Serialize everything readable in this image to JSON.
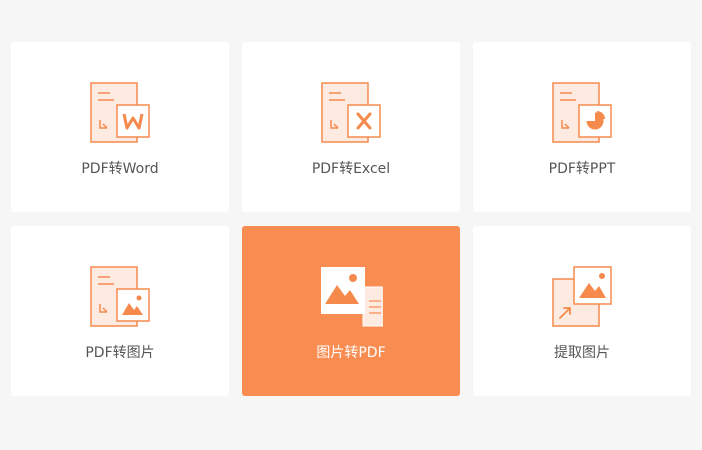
{
  "accent_color": "#f98c51",
  "icon_color": "#f58a4c",
  "tools": [
    {
      "label": "PDF转Word",
      "icon": "pdf-to-word-icon",
      "selected": false
    },
    {
      "label": "PDF转Excel",
      "icon": "pdf-to-excel-icon",
      "selected": false
    },
    {
      "label": "PDF转PPT",
      "icon": "pdf-to-ppt-icon",
      "selected": false
    },
    {
      "label": "PDF转图片",
      "icon": "pdf-to-image-icon",
      "selected": false
    },
    {
      "label": "图片转PDF",
      "icon": "image-to-pdf-icon",
      "selected": true
    },
    {
      "label": "提取图片",
      "icon": "extract-image-icon",
      "selected": false
    }
  ]
}
